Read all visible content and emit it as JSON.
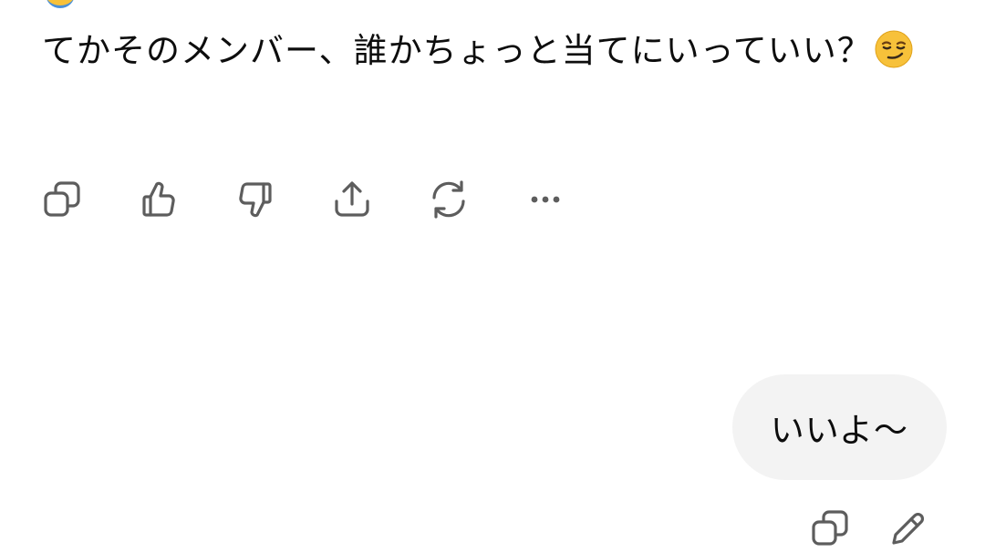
{
  "assistant_message": {
    "text": "てかそのメンバー、誰かちょっと当てにいっていい？",
    "emoji": "smirking-face-emoji"
  },
  "message_actions": [
    {
      "icon": "copy-icon",
      "label": "Copy"
    },
    {
      "icon": "thumbs-up-icon",
      "label": "Good response"
    },
    {
      "icon": "thumbs-down-icon",
      "label": "Bad response"
    },
    {
      "icon": "share-icon",
      "label": "Share"
    },
    {
      "icon": "regenerate-icon",
      "label": "Regenerate"
    },
    {
      "icon": "more-icon",
      "label": "More"
    }
  ],
  "user_message": {
    "text": "いいよ〜"
  },
  "user_actions": [
    {
      "icon": "copy-icon",
      "label": "Copy"
    },
    {
      "icon": "edit-icon",
      "label": "Edit"
    }
  ],
  "colors": {
    "text": "#0d0d0d",
    "icon": "#5d5d5d",
    "bubble": "#f3f3f3",
    "emoji_face": "#f7c13a"
  }
}
